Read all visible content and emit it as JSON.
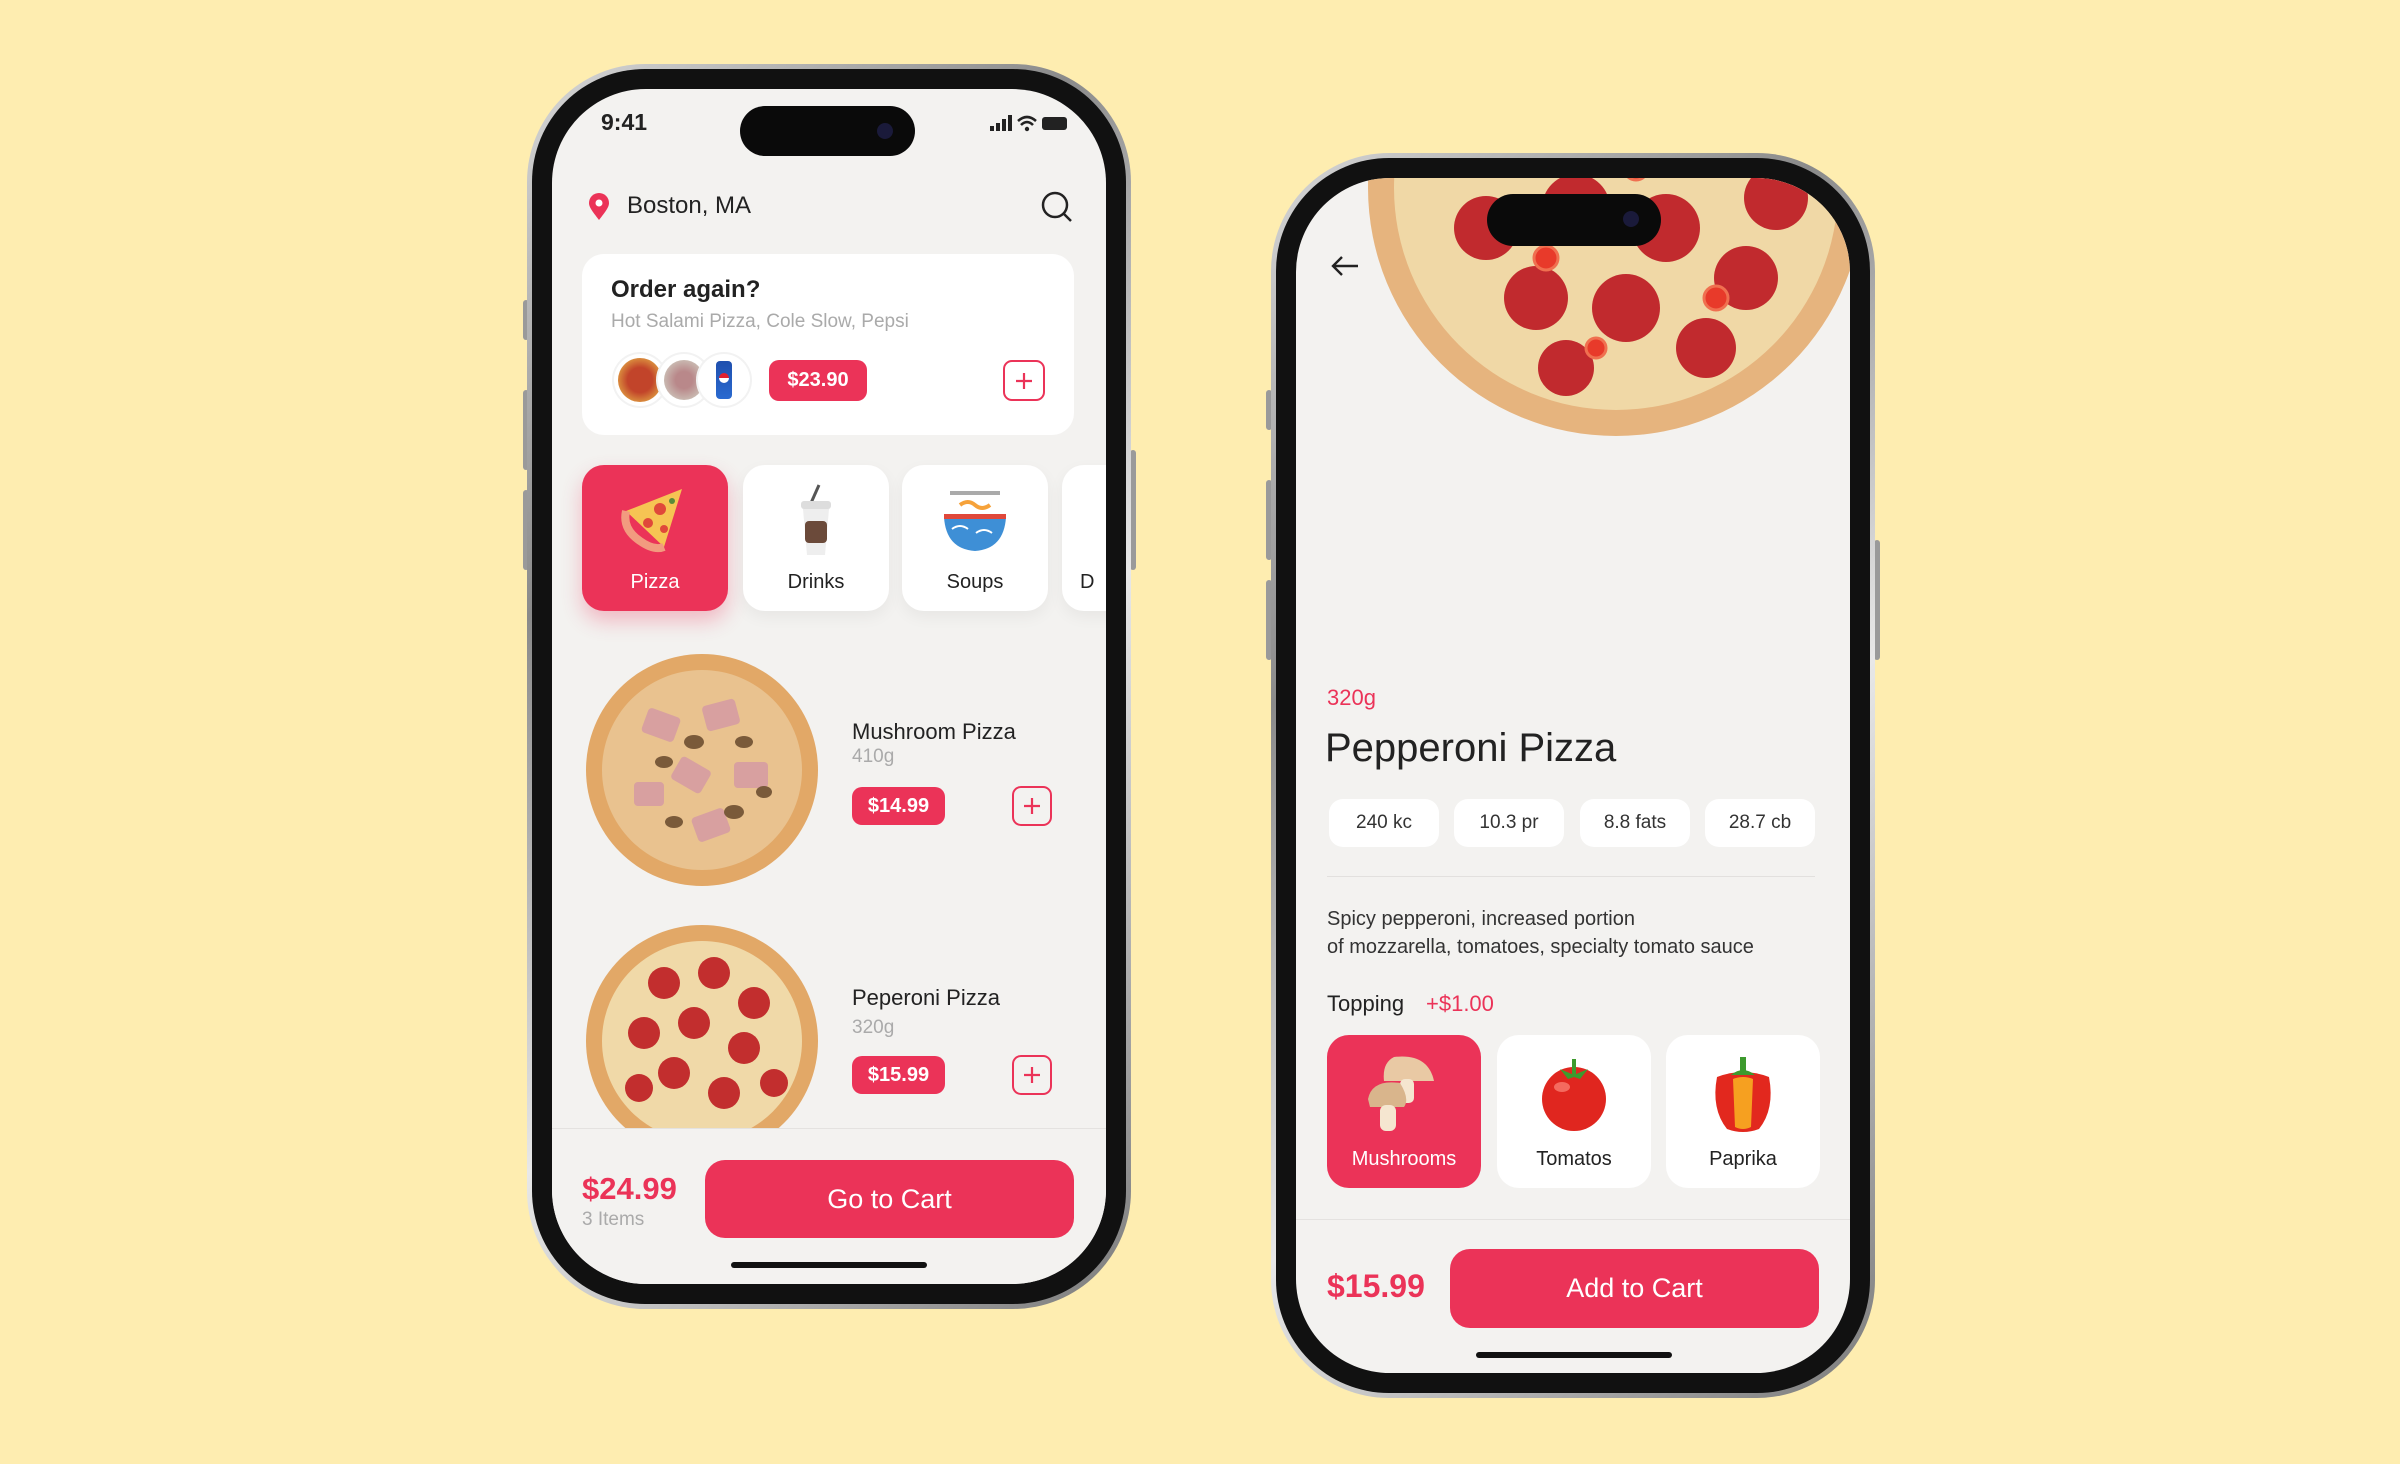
{
  "colors": {
    "background": "#FEEDB0",
    "accent": "#EB3358",
    "screen": "#F3F2F0"
  },
  "left_phone": {
    "status_bar": {
      "time": "9:41",
      "icons": [
        "signal-icon",
        "wifi-icon",
        "battery-icon"
      ]
    },
    "location": {
      "label": "Boston, MA",
      "icon": "location-pin-icon"
    },
    "search_icon": "search-icon",
    "order_again": {
      "title": "Order again?",
      "items": "Hot Salami Pizza, Cole Slow, Pepsi",
      "price": "$23.90"
    },
    "categories": [
      {
        "label": "Pizza",
        "active": true
      },
      {
        "label": "Drinks"
      },
      {
        "label": "Soups"
      },
      {
        "label": "D"
      }
    ],
    "products": [
      {
        "name": "Mushroom Pizza",
        "weight": "410g",
        "price": "$14.99"
      },
      {
        "name": "Peperoni Pizza",
        "weight": "320g",
        "price": "$15.99"
      }
    ],
    "footer": {
      "total": "$24.99",
      "items": "3 Items",
      "button": "Go to Cart"
    }
  },
  "right_phone": {
    "weight": "320g",
    "title": "Pepperoni Pizza",
    "nutrition": [
      "240 kc",
      "10.3 pr",
      "8.8 fats",
      "28.7 cb"
    ],
    "description_line1": "Spicy pepperoni, increased portion",
    "description_line2": "of mozzarella, tomatoes, specialty tomato sauce",
    "topping_label": "Topping",
    "topping_price": "+$1.00",
    "toppings": [
      {
        "label": "Mushrooms",
        "active": true
      },
      {
        "label": "Tomatos"
      },
      {
        "label": "Paprika"
      }
    ],
    "footer": {
      "price": "$15.99",
      "button": "Add to Cart"
    }
  }
}
